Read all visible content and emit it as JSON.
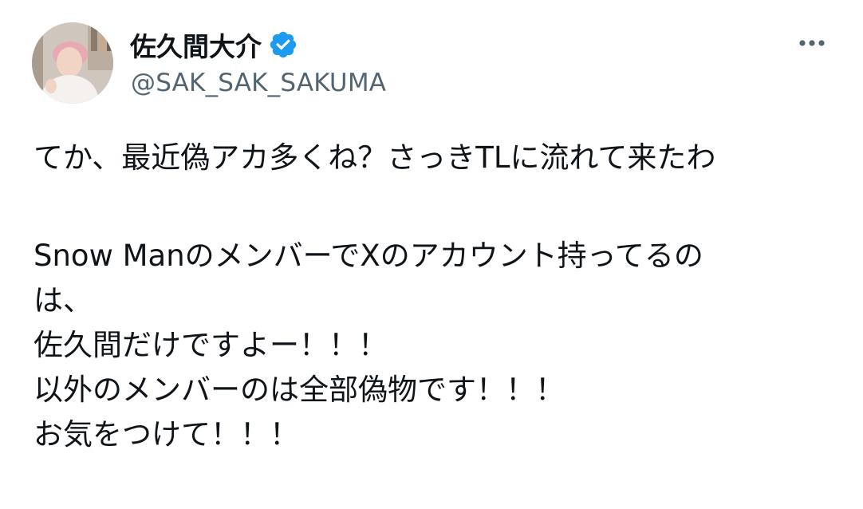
{
  "author": {
    "display_name": "佐久間大介",
    "handle": "@SAK_SAK_SAKUMA",
    "verified": true
  },
  "tweet": {
    "lines": [
      "てか、最近偽アカ多くね？さっきTLに流れて来たわ",
      "",
      "Snow ManのメンバーでXのアカウント持ってるの",
      "は、",
      "佐久間だけですよー！！！",
      "以外のメンバーのは全部偽物です！！！",
      "お気をつけて！！！"
    ]
  },
  "icons": {
    "verified": "verified-badge-icon",
    "more": "more-options-icon"
  },
  "colors": {
    "text": "#0f1419",
    "secondary_text": "#536471",
    "verified_blue": "#1d9bf0"
  }
}
